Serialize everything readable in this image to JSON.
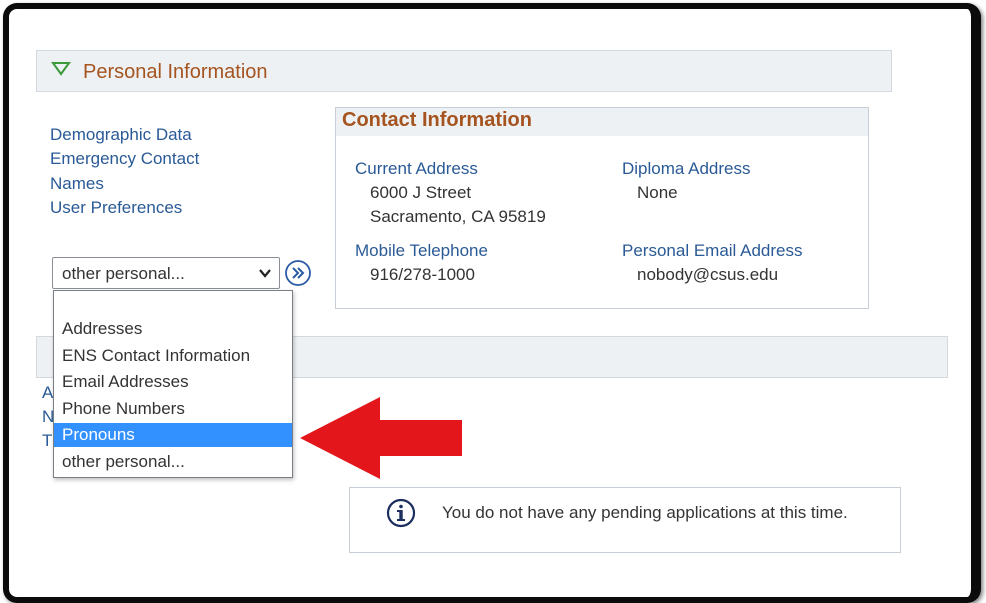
{
  "section": {
    "title": "Personal Information"
  },
  "links": {
    "demographic": "Demographic Data",
    "emergency": "Emergency Contact",
    "names": "Names",
    "preferences": "User Preferences"
  },
  "select": {
    "value": "other personal...",
    "options": [
      "Addresses",
      "ENS Contact Information",
      "Email Addresses",
      "Phone Numbers",
      "Pronouns",
      "other personal..."
    ],
    "highlighted": "Pronouns"
  },
  "contact": {
    "title": "Contact Information",
    "current_address_label": "Current Address",
    "current_address_line1": "6000 J Street",
    "current_address_line2": "Sacramento, CA 95819",
    "diploma_address_label": "Diploma Address",
    "diploma_address_value": "None",
    "mobile_label": "Mobile Telephone",
    "mobile_value": "916/278-1000",
    "email_label": "Personal Email Address",
    "email_value": "nobody@csus.edu"
  },
  "info": {
    "message": "You do not have any pending applications at this time."
  },
  "colors": {
    "link": "#2a5a96",
    "section_title": "#a5541f",
    "highlight": "#3391ff",
    "arrow": "#e3161b",
    "triangle": "#3a9a3a"
  },
  "icons": {
    "expand": "triangle-down-icon",
    "go": "double-chevron-right-icon",
    "info": "info-icon",
    "annotation": "red-arrow"
  }
}
